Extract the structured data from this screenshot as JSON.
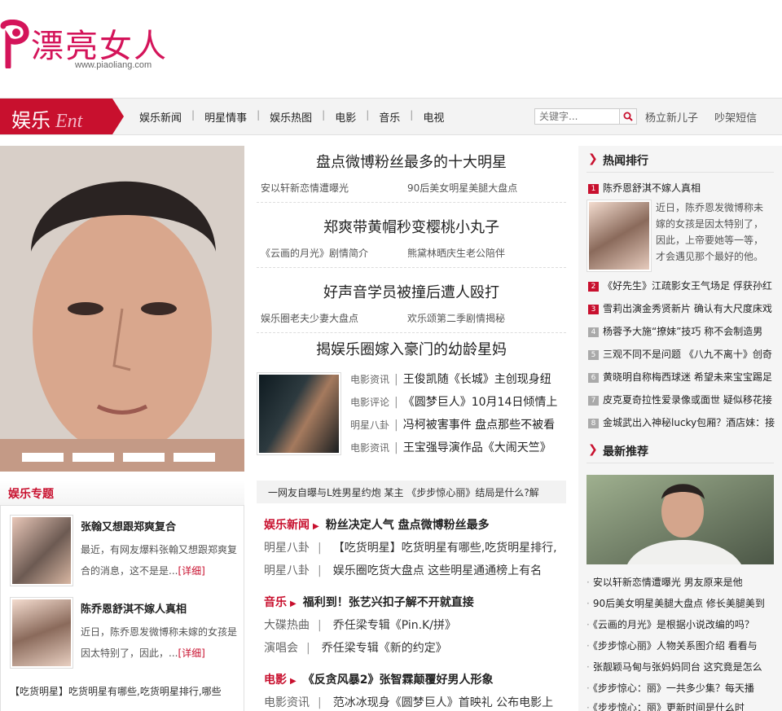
{
  "logo": {
    "text": "漂亮女人",
    "url": "www.piaoliang.com"
  },
  "nav": {
    "badge_cn": "娱乐",
    "badge_en": "Ent",
    "items": [
      "娱乐新闻",
      "明星情事",
      "娱乐热图",
      "电影",
      "音乐",
      "电视"
    ],
    "search_placeholder": "关键字...",
    "extra": [
      "杨立新儿子",
      "吵架短信"
    ]
  },
  "topics": {
    "title": "娱乐专题",
    "items": [
      {
        "title": "张翰又想跟郑爽复合",
        "summary": "最近，有网友爆料张翰又想跟郑爽复合的消息，这不是是...",
        "more": "[详细]"
      },
      {
        "title": "陈乔恩舒淇不嫁人真相",
        "summary": "近日，陈乔恩发微博称未嫁的女孩是因太特别了，因此，...",
        "more": "[详细]"
      }
    ],
    "tail": "【吃货明星】吃货明星有哪些,吃货明星排行,哪些"
  },
  "middle": {
    "headlines": [
      {
        "title": "盘点微博粉丝最多的十大明星",
        "subs": [
          "安以轩新恋情遭曝光",
          "90后美女明星美腿大盘点"
        ]
      },
      {
        "title": "郑爽带黄帽秒变樱桃小丸子",
        "subs": [
          "《云画的月光》剧情简介",
          "熊黛林晒庆生老公陪伴"
        ]
      },
      {
        "title": "好声音学员被撞后遭人殴打",
        "subs": [
          "娱乐圈老夫少妻大盘点",
          "欢乐颂第二季剧情揭秘"
        ]
      },
      {
        "title": "揭娱乐圈嫁入豪门的幼龄星妈",
        "subs": []
      }
    ],
    "feature_rows": [
      {
        "cat": "电影资讯",
        "text": "王俊凯随《长城》主创现身纽"
      },
      {
        "cat": "电影评论",
        "text": "《圆梦巨人》10月14日倾情上"
      },
      {
        "cat": "明星八卦",
        "text": "冯柯被害事件 盘点那些不被看"
      },
      {
        "cat": "电影资讯",
        "text": "王宝强导演作品《大闹天竺》"
      }
    ],
    "ticker": "一网友自曝与L姓男星约炮 某主    《步步惊心丽》结局是什么?解",
    "sections": [
      {
        "cat": "娱乐新闻",
        "title": "粉丝决定人气 盘点微博粉丝最多",
        "rows": [
          {
            "cat": "明星八卦",
            "text": "【吃货明星】吃货明星有哪些,吃货明星排行,"
          },
          {
            "cat": "明星八卦",
            "text": "娱乐圈吃货大盘点 这些明星通通榜上有名"
          }
        ]
      },
      {
        "cat": "音乐",
        "title": "福利到！张艺兴扣子解不开就直接",
        "rows": [
          {
            "cat": "大碟热曲",
            "text": "乔任梁专辑《Pin.K/拼》"
          },
          {
            "cat": "演唱会",
            "text": "乔任梁专辑《新的约定》"
          }
        ]
      },
      {
        "cat": "电影",
        "title": "《反贪风暴2》张智霖颠覆好男人形象",
        "rows": [
          {
            "cat": "电影资讯",
            "text": "范冰冰现身《圆梦巨人》首映礼 公布电影上"
          }
        ]
      }
    ]
  },
  "right": {
    "hot_title": "热闻排行",
    "hot": [
      "陈乔恩舒淇不嫁人真相",
      "《好先生》江疏影女王气场足 俘获孙红",
      "雪莉出演金秀贤新片 确认有大尺度床戏",
      "杨蓉予大施“撩妹”技巧 称不会制造男",
      "三观不同不是问题 《八九不离十》创奇",
      "黄晓明自称梅西球迷 希望未来宝宝踢足",
      "皮克夏奇拉性爱录像或面世 疑似移花接",
      "金城武出入神秘lucky包厢？酒店妹：接"
    ],
    "hot_summary": "近日，陈乔恩发微博称未嫁的女孩是因太特别了，因此，上帝要她等一等，才会遇见那个最好的他。",
    "rec_title": "最新推荐",
    "rec": [
      "安以轩新恋情遭曝光 男友原来是他",
      "90后美女明星美腿大盘点 修长美腿美到",
      "《云画的月光》是根据小说改编的吗？",
      "《步步惊心丽》人物关系图介绍 看看与",
      "张靓颖马甸与张妈妈同台 这究竟是怎么",
      "《步步惊心：丽》一共多少集？每天播",
      "《步步惊心：丽》更新时间是什么时"
    ]
  },
  "colors": {
    "brand": "#d4145a",
    "accent": "#c8102e",
    "rank_top": "#c8102e",
    "rank_rest": "#aaaaaa"
  }
}
